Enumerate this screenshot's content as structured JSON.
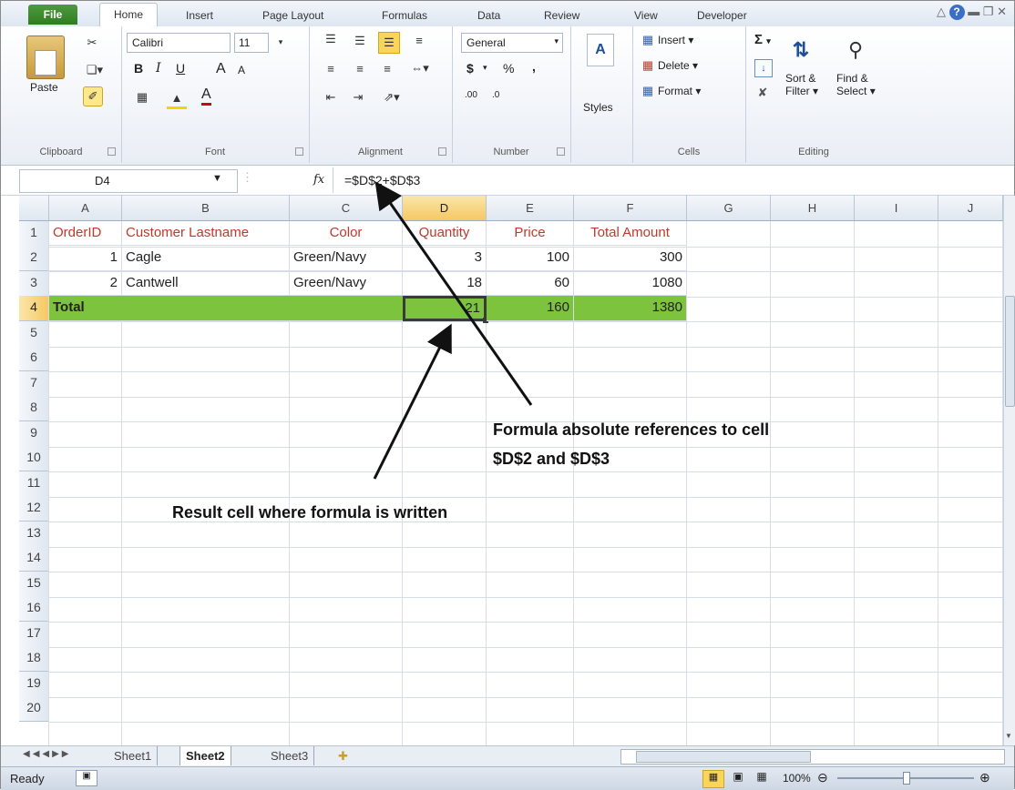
{
  "ribbon_tabs": [
    "File",
    "Home",
    "Insert",
    "Page Layout",
    "Formulas",
    "Data",
    "Review",
    "View",
    "Developer"
  ],
  "clipboard": {
    "paste": "Paste",
    "label": "Clipboard"
  },
  "font": {
    "name": "Calibri",
    "size": "11",
    "bold": "B",
    "italic": "I",
    "underline": "U",
    "grow": "A",
    "shrink": "A",
    "color": "A",
    "label": "Font"
  },
  "alignment": {
    "label": "Alignment"
  },
  "number": {
    "format": "General",
    "currency": "$",
    "percent": "%",
    "comma": ",",
    "inc": ".00",
    "dec": ".0",
    "label": "Number"
  },
  "styles": {
    "label": "Styles"
  },
  "cells": {
    "insert": "Insert",
    "delete": "Delete",
    "format": "Format",
    "label": "Cells"
  },
  "editing": {
    "sum": "Σ",
    "sort": "Sort &",
    "sort2": "Filter",
    "find": "Find &",
    "find2": "Select",
    "label": "Editing"
  },
  "formula_bar": {
    "name_box": "D4",
    "fx": "fx",
    "formula": "=$D$2+$D$3"
  },
  "columns": [
    "A",
    "B",
    "C",
    "D",
    "E",
    "F",
    "G",
    "H",
    "I",
    "J"
  ],
  "rows": [
    "1",
    "2",
    "3",
    "4",
    "5",
    "6",
    "7",
    "8",
    "9",
    "10",
    "11",
    "12",
    "13",
    "14",
    "15",
    "16",
    "17",
    "18",
    "19",
    "20"
  ],
  "table": {
    "headers": [
      "OrderID",
      "Customer Lastname",
      "Color",
      "Quantity",
      "Price",
      "Total Amount"
    ],
    "data": [
      [
        "1",
        "Cagle",
        "Green/Navy",
        "3",
        "100",
        "300"
      ],
      [
        "2",
        "Cantwell",
        "Green/Navy",
        "18",
        "60",
        "1080"
      ]
    ],
    "total": {
      "label": "Total",
      "quantity": "21",
      "price": "160",
      "amount": "1380"
    }
  },
  "annotations": {
    "top_line1": "Formula absolute references to cell",
    "top_line2": "$D$2 and $D$3",
    "bottom": "Result cell where formula is written"
  },
  "sheets": [
    "Sheet1",
    "Sheet2",
    "Sheet3"
  ],
  "active_sheet": "Sheet2",
  "status": {
    "ready": "Ready",
    "zoom": "100%"
  },
  "colors": {
    "header_red": "#c0392b",
    "total_green": "#7ec33e",
    "file_green": "#2f7d22"
  }
}
